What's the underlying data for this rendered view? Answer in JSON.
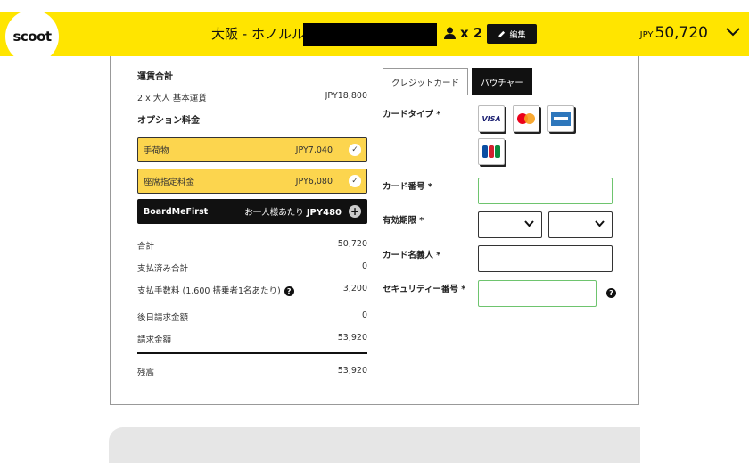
{
  "header": {
    "logo_text": "scoot",
    "route": "大阪 - ホノルル,",
    "pax_count": "x 2",
    "edit_label": "編集",
    "currency": "JPY",
    "total_price": "50,720"
  },
  "summary": {
    "fare_title": "運賃合計",
    "fare_row": {
      "label": "2 x 大人 基本運賃",
      "value": "JPY18,800"
    },
    "options_title": "オプション料金",
    "options": [
      {
        "label": "手荷物",
        "value": "JPY7,040"
      },
      {
        "label": "座席指定料金",
        "value": "JPY6,080"
      }
    ],
    "boardmefirst": {
      "label": "BoardMeFirst",
      "prefix": "お一人様あたり",
      "value": "JPY480"
    },
    "rows": [
      {
        "label": "合計",
        "value": "50,720"
      },
      {
        "label": "支払済み合計",
        "value": "0"
      },
      {
        "label": "支払手数料 (1,600 搭乗者1名あたり)",
        "value": "3,200"
      },
      {
        "label": "後日請求金額",
        "value": "0"
      },
      {
        "label": "請求金額",
        "value": "53,920"
      }
    ],
    "balance": {
      "label": "残高",
      "value": "53,920"
    }
  },
  "payment": {
    "tabs": [
      "クレジットカード",
      "バウチャー"
    ],
    "card_type_label": "カードタイプ *",
    "card_brands": [
      "VISA",
      "mastercard",
      "AMEX",
      "JCB"
    ],
    "card_number_label": "カード番号 *",
    "expiry_label": "有効期限 *",
    "holder_label": "カード名義人 *",
    "security_label": "セキュリティー番号 *"
  }
}
